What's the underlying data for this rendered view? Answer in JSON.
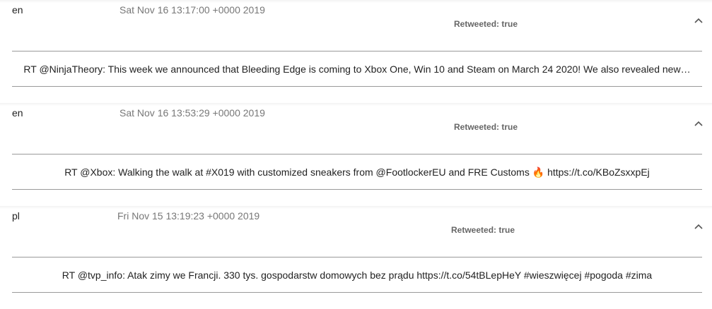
{
  "tweets": [
    {
      "lang": "en",
      "date": "Sat Nov 16 13:17:00 +0000 2019",
      "retweeted": "Retweeted: true",
      "text": "RT @NinjaTheory: This week we announced that Bleeding Edge is coming to Xbox One, Win 10 and Steam on March 24 2020! We also revealed new…"
    },
    {
      "lang": "en",
      "date": "Sat Nov 16 13:53:29 +0000 2019",
      "retweeted": "Retweeted: true",
      "text_before": "RT @Xbox: Walking the walk at #X019 with customized sneakers from @FootlockerEU and FRE Customs",
      "emoji": "🔥",
      "text_after": "https://t.co/KBoZsxxpEj"
    },
    {
      "lang": "pl",
      "date": "Fri Nov 15 13:19:23 +0000 2019",
      "retweeted": "Retweeted: true",
      "text": "RT @tvp_info: Atak zimy we Francji. 330 tys. gospodarstw domowych bez prądu https://t.co/54tBLepHeY #wieszwięcej #pogoda #zima"
    }
  ],
  "icons": {
    "collapse": "chevron-up-icon"
  }
}
